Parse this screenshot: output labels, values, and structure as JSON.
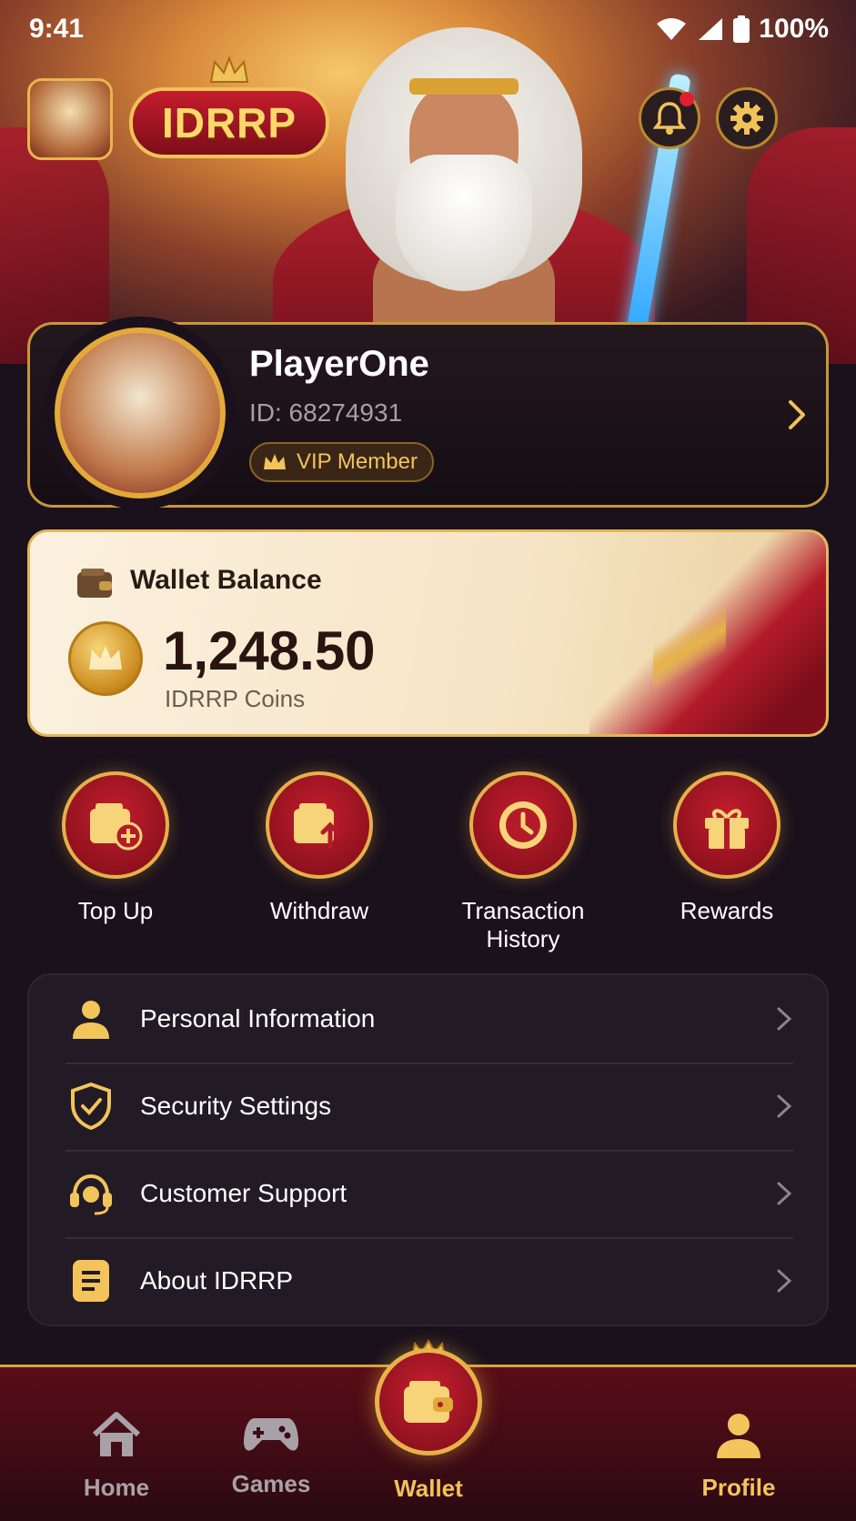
{
  "status_bar": {
    "time": "9:41",
    "battery": "100%"
  },
  "header": {
    "logo_text": "IDRRP",
    "has_notification": true
  },
  "profile": {
    "name": "PlayerOne",
    "id_text": "ID: 68274931",
    "badge": "VIP Member"
  },
  "wallet": {
    "title": "Wallet Balance",
    "balance": "1,248.50",
    "unit": "IDRRP Coins"
  },
  "actions": [
    {
      "label": "Top Up",
      "icon": "wallet-add-icon"
    },
    {
      "label": "Withdraw",
      "icon": "wallet-withdraw-icon"
    },
    {
      "label": "Transaction History",
      "icon": "clock-icon"
    },
    {
      "label": "Rewards",
      "icon": "gift-icon"
    }
  ],
  "menu": [
    {
      "label": "Personal Information",
      "icon": "person-icon"
    },
    {
      "label": "Security Settings",
      "icon": "shield-icon"
    },
    {
      "label": "Customer Support",
      "icon": "headset-icon"
    },
    {
      "label": "About IDRRP",
      "icon": "document-icon"
    }
  ],
  "nav": {
    "home": "Home",
    "games": "Games",
    "wallet": "Wallet",
    "profile": "Profile",
    "active": "Profile"
  },
  "colors": {
    "accent_gold": "#e6b04a",
    "accent_red": "#b31b2a",
    "background": "#1a111c"
  }
}
